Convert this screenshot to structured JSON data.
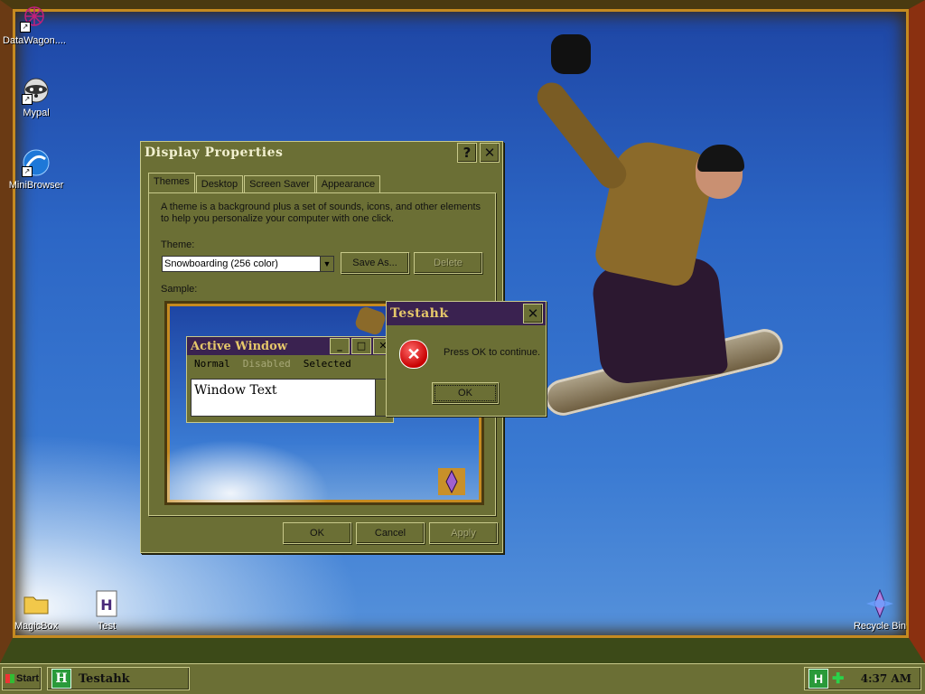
{
  "desktop": {
    "icons": [
      {
        "label": "DataWagon...."
      },
      {
        "label": "Mypal"
      },
      {
        "label": "MiniBrowser"
      },
      {
        "label": "MagicBox"
      },
      {
        "label": "Test"
      },
      {
        "label": "Recycle Bin"
      }
    ]
  },
  "display_properties": {
    "title": "Display Properties",
    "help_label": "?",
    "close_label": "✕",
    "tabs": [
      "Themes",
      "Desktop",
      "Screen Saver",
      "Appearance"
    ],
    "description": "A theme is a background plus a set of sounds, icons, and other elements to help you personalize your computer with one click.",
    "theme_label": "Theme:",
    "theme_value": "Snowboarding (256 color)",
    "save_as_label": "Save As...",
    "delete_label": "Delete",
    "sample_label": "Sample:",
    "ok_label": "OK",
    "cancel_label": "Cancel",
    "apply_label": "Apply"
  },
  "sample_window": {
    "title": "Active Window",
    "menu": [
      "Normal",
      "Disabled",
      "Selected"
    ],
    "text": "Window Text"
  },
  "message_box": {
    "title": "Testahk",
    "message": "Press OK to continue.",
    "ok_label": "OK"
  },
  "taskbar": {
    "start_label": "Start",
    "task_label": "Testahk",
    "clock": "4:37 AM"
  },
  "colors": {
    "chrome": "#6b6f35",
    "active_title": "#3a2250",
    "title_text": "#e6c86a"
  }
}
